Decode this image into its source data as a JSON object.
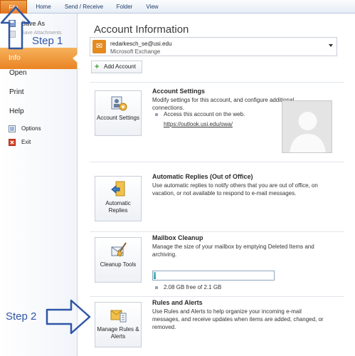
{
  "tabs": {
    "file": "File",
    "home": "Home",
    "send_receive": "Send / Receive",
    "folder": "Folder",
    "view": "View"
  },
  "sidebar": {
    "save_as": "Save As",
    "save_attachments": "Save Attachments",
    "info": "Info",
    "open": "Open",
    "print": "Print",
    "help": "Help",
    "options": "Options",
    "exit": "Exit"
  },
  "annotations": {
    "step1": "Step 1",
    "step2": "Step 2"
  },
  "main": {
    "title": "Account Information",
    "account_email": "redarkesch_se@usi.edu",
    "account_type": "Microsoft Exchange",
    "add_account": "Add Account",
    "account_settings": {
      "button": "Account Settings",
      "heading": "Account Settings",
      "description": "Modify settings for this account, and configure additional connections.",
      "bullet": "Access this account on the web.",
      "link": "https://outlook.usi.edu/owa/"
    },
    "auto_replies": {
      "button": "Automatic Replies",
      "heading": "Automatic Replies (Out of Office)",
      "description": "Use automatic replies to notify others that you are out of office, on vacation, or not available to respond to e-mail messages."
    },
    "mailbox_cleanup": {
      "button": "Cleanup Tools",
      "heading": "Mailbox Cleanup",
      "description": "Manage the size of your mailbox by emptying Deleted Items and archiving.",
      "quota_text": "2.08 GB free of 2.1 GB",
      "quota_used_fraction": 0.01
    },
    "rules_alerts": {
      "button": "Manage Rules & Alerts",
      "heading": "Rules and Alerts",
      "description": "Use Rules and Alerts to help organize your incoming e-mail messages, and receive updates when items are added, changed, or removed."
    }
  },
  "colors": {
    "file_tab": "#e2731c",
    "info_highlight": "#ea8424",
    "annotation_blue": "#2f56a6"
  }
}
